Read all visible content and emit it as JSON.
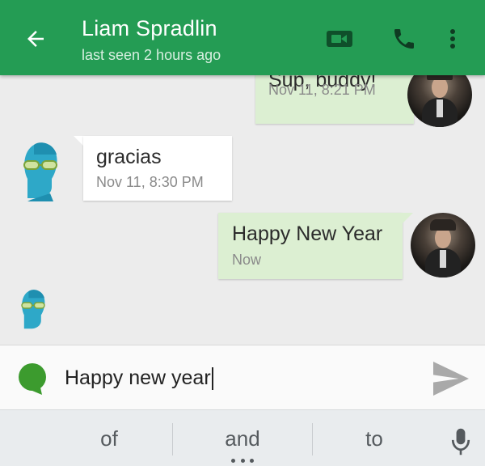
{
  "colors": {
    "appbar": "#249c54",
    "outgoing_bubble": "#dcefd2",
    "incoming_bubble": "#ffffff",
    "background": "#ececec",
    "emoji_button": "#3c9b2e"
  },
  "header": {
    "contact_name": "Liam Spradlin",
    "status": "last seen 2 hours ago",
    "icons": [
      "back-arrow-icon",
      "video-call-icon",
      "phone-icon",
      "more-vert-icon"
    ]
  },
  "messages": [
    {
      "direction": "outgoing",
      "text": "Sup, buddy!",
      "time": "Nov 11, 8:21 PM"
    },
    {
      "direction": "incoming",
      "text": "gracias",
      "time": "Nov 11, 8:30 PM"
    },
    {
      "direction": "outgoing",
      "text": "Happy New Year",
      "time": "Now"
    }
  ],
  "compose": {
    "value": "Happy new year",
    "icons": [
      "emoji-icon",
      "send-icon"
    ]
  },
  "keyboard": {
    "suggestions": [
      "of",
      "and",
      "to"
    ],
    "icons": [
      "microphone-icon"
    ]
  }
}
